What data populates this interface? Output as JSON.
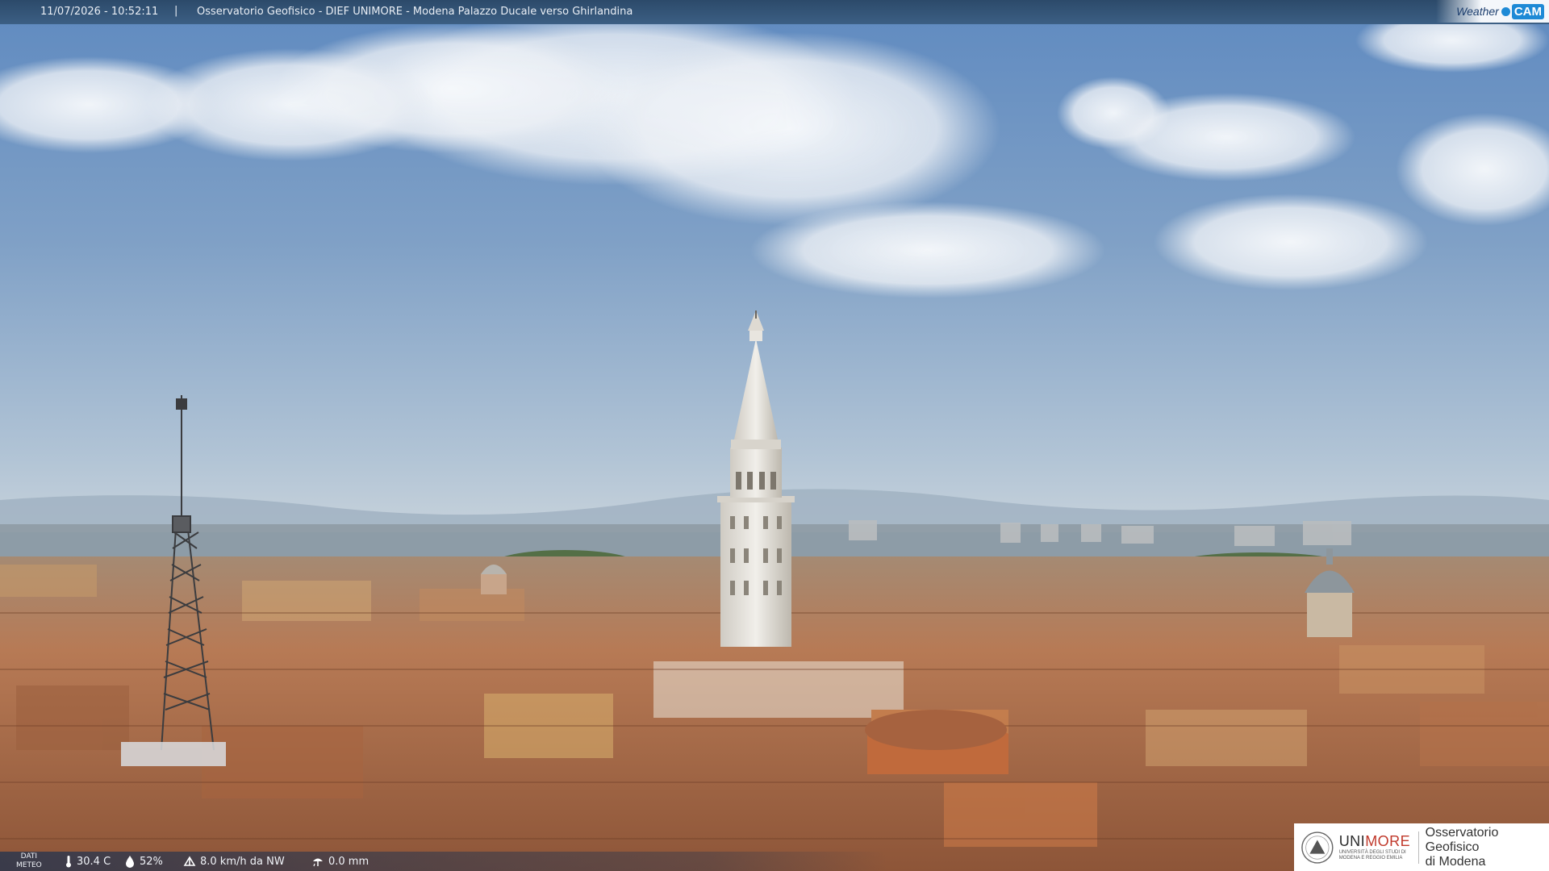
{
  "header": {
    "datetime": "11/07/2026 - 10:52:11",
    "separator": "|",
    "title": "Osservatorio Geofisico - DIEF UNIMORE - Modena Palazzo Ducale verso Ghirlandina"
  },
  "brand": {
    "weather": "Weather",
    "cam": "CAM"
  },
  "weather_bar": {
    "label_line1": "DATI",
    "label_line2": "METEO",
    "temperature": "30.4 C",
    "humidity": "52%",
    "wind": "8.0 km/h da NW",
    "rain": "0.0 mm"
  },
  "logo": {
    "uni_part1": "UNI",
    "uni_part2": "MORE",
    "uni_sub_line1": "UNIVERSITÀ DEGLI STUDI DI",
    "uni_sub_line2": "MODENA E REGGIO EMILIA",
    "observatory_line1": "Osservatorio Geofisico",
    "observatory_line2": "di Modena"
  },
  "icons": {
    "temperature": "thermometer-icon",
    "humidity": "droplet-icon",
    "wind": "wind-icon",
    "rain": "rain-gauge-icon"
  },
  "colors": {
    "sky_top": "#6f95c4",
    "sky_horizon": "#b8c9d8",
    "roof": "#b5714a",
    "tower": "#e4e1da",
    "bar": "#2c4a6a",
    "accent": "#1e8ad6"
  }
}
